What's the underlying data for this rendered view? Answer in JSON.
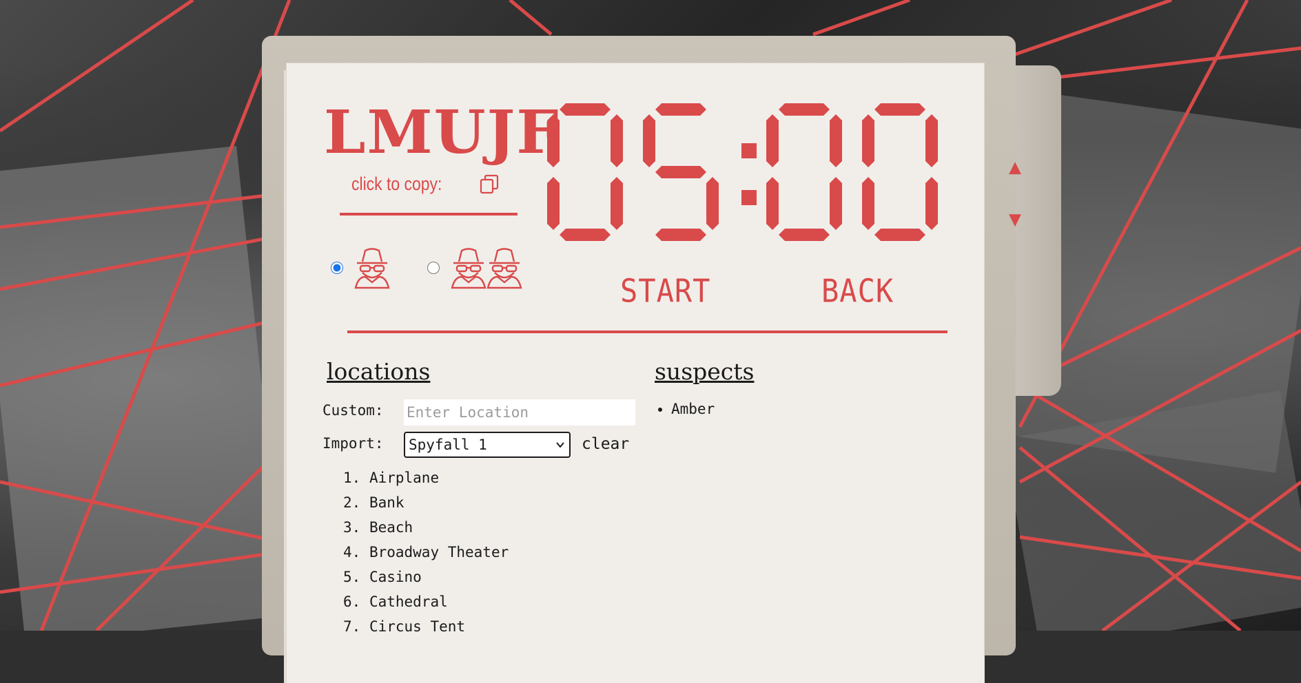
{
  "theme": {
    "accent": "#d94a4a",
    "paper": "#f1eeea",
    "ink": "#1b1b1b"
  },
  "game": {
    "code": "LMUJF",
    "copy_label": "click to copy:",
    "copy_icon": "copy-icon",
    "modes": [
      {
        "icon": "spy-icon",
        "spy_count": 1,
        "selected": true
      },
      {
        "icon": "spy-icon",
        "spy_count": 2,
        "selected": false
      }
    ]
  },
  "timer": {
    "display": "05:00",
    "increase_icon": "triangle-up-icon",
    "decrease_icon": "triangle-down-icon",
    "start_label": "START",
    "back_label": "BACK"
  },
  "locations": {
    "title": "locations",
    "custom_label": "Custom:",
    "custom_placeholder": "Enter Location",
    "import_label": "Import:",
    "import_selected": "Spyfall 1",
    "clear_label": "clear",
    "items": [
      "Airplane",
      "Bank",
      "Beach",
      "Broadway Theater",
      "Casino",
      "Cathedral",
      "Circus Tent"
    ]
  },
  "suspects": {
    "title": "suspects",
    "items": [
      "Amber"
    ]
  }
}
